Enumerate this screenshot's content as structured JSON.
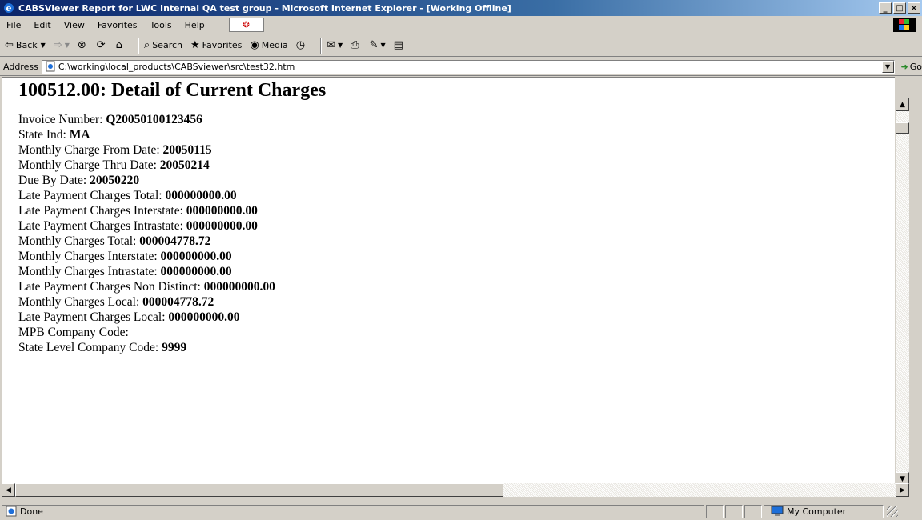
{
  "window": {
    "title": "CABSViewer Report for LWC Internal QA test group - Microsoft Internet Explorer - [Working Offline]",
    "buttons": [
      "_",
      "□",
      "×"
    ]
  },
  "menu": {
    "items": [
      "File",
      "Edit",
      "View",
      "Favorites",
      "Tools",
      "Help"
    ]
  },
  "toolbar": {
    "back_label": "Back",
    "search_label": "Search",
    "favorites_label": "Favorites",
    "media_label": "Media"
  },
  "address": {
    "label": "Address",
    "url": "C:\\working\\local_products\\CABSviewer\\src\\test32.htm",
    "go_label": "Go"
  },
  "document": {
    "heading": "100512.00: Detail of Current Charges",
    "fields": [
      {
        "label": "Invoice Number: ",
        "value": "Q20050100123456"
      },
      {
        "label": "State Ind: ",
        "value": "MA"
      },
      {
        "label": "Monthly Charge From Date: ",
        "value": "20050115"
      },
      {
        "label": "Monthly Charge Thru Date: ",
        "value": "20050214"
      },
      {
        "label": "Due By Date: ",
        "value": "20050220"
      },
      {
        "label": "Late Payment Charges Total: ",
        "value": "000000000.00"
      },
      {
        "label": "Late Payment Charges Interstate: ",
        "value": "000000000.00"
      },
      {
        "label": "Late Payment Charges Intrastate: ",
        "value": "000000000.00"
      },
      {
        "label": "Monthly Charges Total: ",
        "value": "000004778.72"
      },
      {
        "label": "Monthly Charges Interstate: ",
        "value": "000000000.00"
      },
      {
        "label": "Monthly Charges Intrastate: ",
        "value": "000000000.00"
      },
      {
        "label": "Late Payment Charges Non Distinct: ",
        "value": "000000000.00"
      },
      {
        "label": "Monthly Charges Local: ",
        "value": "000004778.72"
      },
      {
        "label": "Late Payment Charges Local: ",
        "value": "000000000.00"
      },
      {
        "label": "MPB Company Code: ",
        "value": ""
      },
      {
        "label": "State Level Company Code: ",
        "value": "9999"
      }
    ]
  },
  "status": {
    "text": "Done",
    "zone": "My Computer"
  }
}
